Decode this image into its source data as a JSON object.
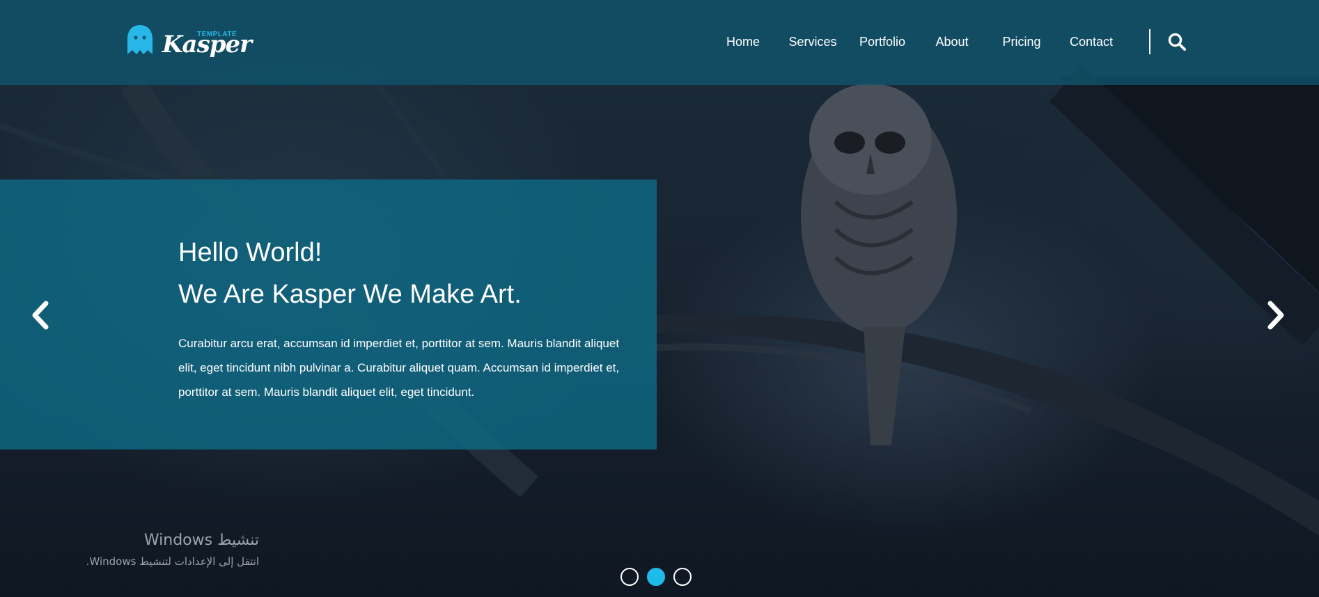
{
  "brand": {
    "name": "Kasper",
    "tagline": "TEMPLATE",
    "accent": "#1ebbe8"
  },
  "nav": {
    "items": [
      {
        "label": "Home"
      },
      {
        "label": "Services"
      },
      {
        "label": "Portfolio"
      },
      {
        "label": "About"
      },
      {
        "label": "Pricing"
      },
      {
        "label": "Contact"
      }
    ],
    "search_icon": "search-icon"
  },
  "hero": {
    "title_line1": "Hello World!",
    "title_line2": "We Are Kasper We Make Art.",
    "body": "Curabitur arcu erat, accumsan id imperdiet et, porttitor at sem. Mauris blandit aliquet elit, eget tincidunt nibh pulvinar a. Curabitur aliquet quam. Accumsan id imperdiet et, porttitor at sem. Mauris blandit aliquet elit, eget tincidunt.",
    "prev_icon": "chevron-left-icon",
    "next_icon": "chevron-right-icon"
  },
  "slider": {
    "slide_count": 3,
    "active_index": 1
  },
  "watermark": {
    "line1": "تنشيط Windows",
    "line2": "انتقل إلى الإعدادات لتنشيط Windows."
  }
}
